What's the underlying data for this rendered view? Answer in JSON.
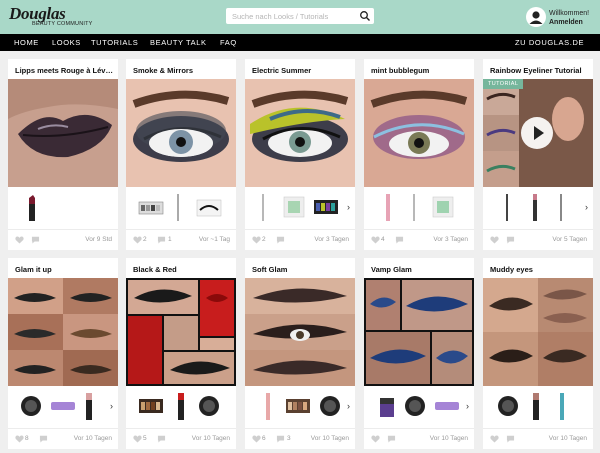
{
  "brand": {
    "name": "Douglas",
    "tagline": "BEAUTY COMMUNITY"
  },
  "search": {
    "placeholder": "Suche nach Looks / Tutorials",
    "icon": "search-icon"
  },
  "user": {
    "greeting": "Willkommen!",
    "login": "Anmelden",
    "icon": "avatar-icon"
  },
  "nav": {
    "items": [
      "HOME",
      "LOOKS",
      "TUTORIALS",
      "BEAUTY TALK",
      "FAQ"
    ],
    "right": "ZU DOUGLAS.DE"
  },
  "cards": [
    {
      "title": "Lipps meets Rouge à Lév…",
      "likes": "",
      "comments": "",
      "time": "Vor 9 Std"
    },
    {
      "title": "Smoke & Mirrors",
      "likes": "2",
      "comments": "1",
      "time": "Vor ~1 Tag"
    },
    {
      "title": "Electric Summer",
      "likes": "2",
      "comments": "",
      "time": "Vor 3 Tagen"
    },
    {
      "title": "mint bubblegum",
      "likes": "4",
      "comments": "",
      "time": "Vor 3 Tagen"
    },
    {
      "title": "Rainbow Eyeliner Tutorial",
      "tag": "TUTORIAL",
      "likes": "",
      "comments": "",
      "time": "Vor 5 Tagen"
    },
    {
      "title": "Glam it up",
      "likes": "8",
      "comments": "",
      "time": "Vor 10 Tagen"
    },
    {
      "title": "Black & Red",
      "likes": "5",
      "comments": "",
      "time": "Vor 10 Tagen"
    },
    {
      "title": "Soft Glam",
      "likes": "6",
      "comments": "3",
      "time": "Vor 10 Tagen"
    },
    {
      "title": "Vamp Glam",
      "likes": "",
      "comments": "",
      "time": "Vor 10 Tagen"
    },
    {
      "title": "Muddy eyes",
      "likes": "",
      "comments": "",
      "time": "Vor 10 Tagen"
    }
  ],
  "colors": {
    "header": "#a9d8c8",
    "nav": "#000000",
    "tag": "#76b69c",
    "background": "#efefef"
  }
}
